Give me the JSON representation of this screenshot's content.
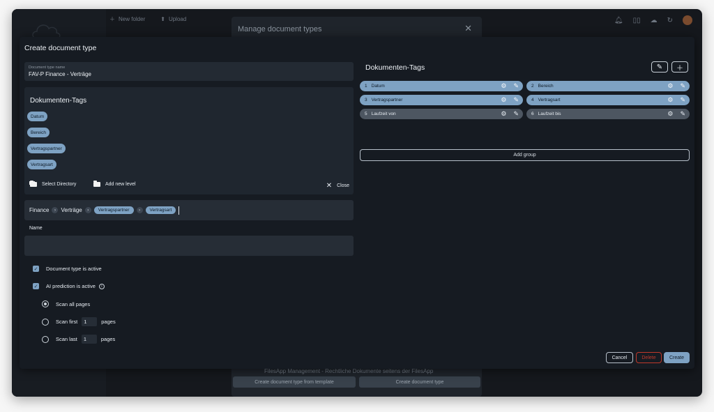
{
  "background": {
    "toolbar": {
      "new_folder": "New folder",
      "upload": "Upload"
    },
    "manage_dialog": {
      "title": "Manage document types",
      "row_text": "FilesApp Management - Rechtliche Dokumente seitens der FilesApp",
      "template_button": "Create document type from template",
      "create_button": "Create document type"
    }
  },
  "modal": {
    "title": "Create document type",
    "name_field": {
      "label": "Document type name",
      "value": "FAV-P Finance - Verträge"
    },
    "tags_panel": {
      "title": "Dokumenten-Tags",
      "tags": [
        "Datum",
        "Bereich",
        "Vertragspartner",
        "Vertragsart"
      ],
      "select_directory": "Select Directory",
      "add_new_level": "Add new level",
      "close": "Close"
    },
    "path": {
      "segments": [
        "Finance",
        "Verträge"
      ],
      "pills": [
        "Vertragspartner",
        "Vertragsart"
      ]
    },
    "name_label": "Name",
    "name_value": "",
    "options": {
      "active": "Document type is active",
      "ai_prediction": "AI prediction is active",
      "scan_all": "Scan all pages",
      "scan_first": "Scan first",
      "scan_first_value": "1",
      "scan_last": "Scan last",
      "scan_last_value": "1",
      "pages": "pages"
    },
    "right": {
      "title": "Dokumenten-Tags",
      "groups": [
        {
          "num": "1",
          "label": "Datum",
          "style": "blue"
        },
        {
          "num": "2",
          "label": "Bereich",
          "style": "blue"
        },
        {
          "num": "3",
          "label": "Vertragspartner",
          "style": "blue"
        },
        {
          "num": "4",
          "label": "Vertragsart",
          "style": "blue"
        },
        {
          "num": "5",
          "label": "Laufzeit von",
          "style": "grey"
        },
        {
          "num": "6",
          "label": "Laufzeit bis",
          "style": "grey"
        }
      ],
      "add_group": "Add group"
    },
    "footer": {
      "cancel": "Cancel",
      "delete": "Delete",
      "create": "Create"
    }
  },
  "colors": {
    "accent": "#7ea2c3",
    "delete": "#c0392b",
    "panel": "#1f262f"
  }
}
